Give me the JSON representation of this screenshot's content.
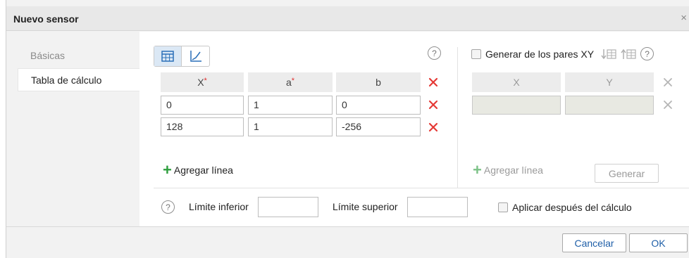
{
  "dialog": {
    "title": "Nuevo sensor",
    "close_glyph": "×"
  },
  "sidebar": {
    "items": [
      {
        "label": "Básicas",
        "state": "inactive"
      },
      {
        "label": "Tabla de cálculo",
        "state": "active"
      }
    ]
  },
  "calc_table": {
    "headers": {
      "x": "X",
      "a": "a",
      "b": "b"
    },
    "required_mark": "*",
    "rows": [
      {
        "x": "0",
        "a": "1",
        "b": "0"
      },
      {
        "x": "128",
        "a": "1",
        "b": "-256"
      }
    ],
    "add_line_label": "Agregar línea"
  },
  "xy_pairs": {
    "generate_label": "Generar de los pares XY",
    "headers": {
      "x": "X",
      "y": "Y"
    },
    "add_line_label": "Agregar línea",
    "generate_button": "Generar"
  },
  "limits": {
    "lower_label": "Límite inferior",
    "upper_label": "Límite superior",
    "lower_value": "",
    "upper_value": "",
    "apply_after_label": "Aplicar después del cálculo"
  },
  "help_glyph": "?",
  "footer": {
    "cancel_label": "Cancelar",
    "ok_label": "OK"
  },
  "colors": {
    "delete_active": "#e53935",
    "delete_disabled": "#b5b5b5",
    "add_green": "#2e9e3e",
    "add_green_disabled": "#7cc287",
    "link_blue": "#1f5fa8",
    "header_bg": "#ececec",
    "disabled_cell_bg": "#e8e9e2"
  },
  "icons": {
    "table_view": "table-icon",
    "chart_view": "chart-icon",
    "sort_down": "sort-down-icon",
    "sort_up": "sort-up-icon",
    "delete": "delete-x-icon",
    "add": "plus-icon"
  }
}
